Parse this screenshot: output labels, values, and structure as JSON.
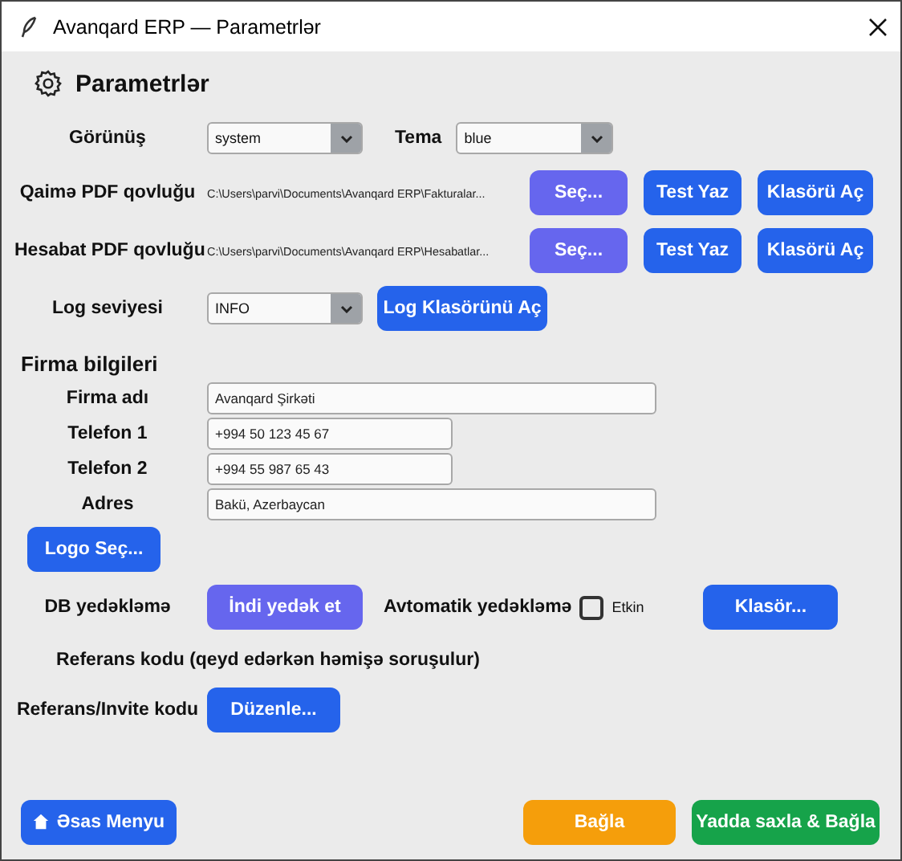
{
  "window": {
    "title": "Avanqard ERP — Parametrlər"
  },
  "heading": "Parametrlər",
  "appearance": {
    "label": "Görünüş",
    "value": "system",
    "theme_label": "Tema",
    "theme_value": "blue"
  },
  "folders": [
    {
      "label": "Qaimə PDF qovluğu",
      "path": "C:\\Users\\parvi\\Documents\\Avanqard ERP\\Fakturalar...",
      "buttons": [
        {
          "label": "Seç...",
          "kind": "secondary"
        },
        {
          "label": "Test Yaz",
          "kind": "primary"
        },
        {
          "label": "Klasörü Aç",
          "kind": "primary"
        }
      ]
    },
    {
      "label": "Hesabat PDF qovluğu",
      "path": "C:\\Users\\parvi\\Documents\\Avanqard ERP\\Hesabatlar...",
      "buttons": [
        {
          "label": "Seç...",
          "kind": "secondary"
        },
        {
          "label": "Test Yaz",
          "kind": "primary"
        },
        {
          "label": "Klasörü Aç",
          "kind": "primary"
        }
      ]
    }
  ],
  "log": {
    "label": "Log seviyesi",
    "value": "INFO",
    "button": "Log Klasörünü Aç"
  },
  "company": {
    "title": "Firma bilgileri",
    "fields": [
      {
        "label": "Firma adı",
        "value": "Avanqard Şirkəti",
        "kind": "wide"
      },
      {
        "label": "Telefon 1",
        "value": "+994 50 123 45 67",
        "kind": "short"
      },
      {
        "label": "Telefon 2",
        "value": "+994 55 987 65 43",
        "kind": "short"
      },
      {
        "label": "Adres",
        "value": "Bakü, Azerbaycan",
        "kind": "wide"
      }
    ],
    "logo_button": "Logo Seç..."
  },
  "backup": {
    "label": "DB yedəkləmə",
    "button": "İndi yedək et",
    "auto_label": "Avtomatik yedəkləmə",
    "auto_checked": false,
    "checkbox_label": "Etkin",
    "folder_button": "Klasör..."
  },
  "referral": {
    "note": "Referans kodu (qeyd edərkən həmişə soruşulur)",
    "label": "Referans/Invite kodu",
    "button": "Düzenle..."
  },
  "footer": [
    {
      "label": "Əsas Menyu",
      "kind": "home"
    },
    {
      "label": "Bağla",
      "kind": "close"
    },
    {
      "label": "Yadda saxla & Bağla",
      "kind": "save"
    }
  ]
}
